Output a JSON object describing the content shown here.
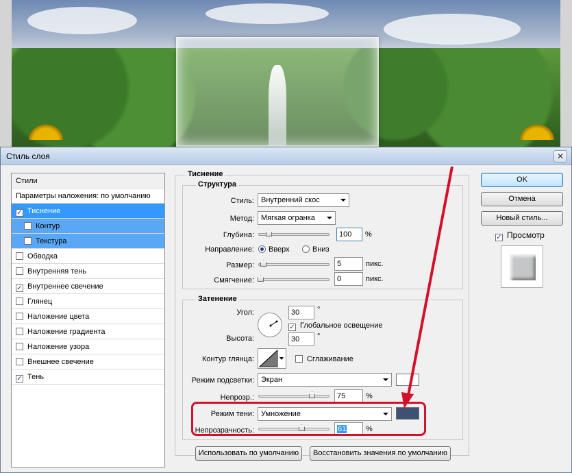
{
  "dialog": {
    "title": "Стиль слоя",
    "close_glyph": "✕"
  },
  "styles_panel": {
    "header": "Стили",
    "blend_defaults": "Параметры наложения: по умолчанию",
    "items": [
      {
        "label": "Тиснение",
        "checked": true,
        "selected": true
      },
      {
        "label": "Контур",
        "checked": false,
        "sub": true
      },
      {
        "label": "Текстура",
        "checked": false,
        "sub": true
      },
      {
        "label": "Обводка",
        "checked": false
      },
      {
        "label": "Внутренняя тень",
        "checked": false
      },
      {
        "label": "Внутреннее свечение",
        "checked": true
      },
      {
        "label": "Глянец",
        "checked": false
      },
      {
        "label": "Наложение цвета",
        "checked": false
      },
      {
        "label": "Наложение градиента",
        "checked": false
      },
      {
        "label": "Наложение узора",
        "checked": false
      },
      {
        "label": "Внешнее свечение",
        "checked": false
      },
      {
        "label": "Тень",
        "checked": true
      }
    ]
  },
  "bevel": {
    "title": "Тиснение",
    "structure": {
      "title": "Структура",
      "style_label": "Стиль:",
      "style_value": "Внутренний скос",
      "method_label": "Метод:",
      "method_value": "Мягкая огранка",
      "depth_label": "Глубина:",
      "depth_value": "100",
      "depth_unit": "%",
      "depth_level": 0.1,
      "direction_label": "Направление:",
      "dir_up": "Вверх",
      "dir_down": "Вниз",
      "size_label": "Размер:",
      "size_value": "5",
      "size_unit": "пикс.",
      "soften_label": "Смягчение:",
      "soften_value": "0",
      "soften_unit": "пикс."
    },
    "shading": {
      "title": "Затенение",
      "angle_label": "Угол:",
      "angle_value": "30",
      "deg": "°",
      "global_light": "Глобальное освещение",
      "altitude_label": "Высота:",
      "altitude_value": "30",
      "gloss_label": "Контур глянца:",
      "antialias": "Сглаживание",
      "highlight_mode_label": "Режим подсветки:",
      "highlight_mode_value": "Экран",
      "highlight_color": "#ffffff",
      "highlight_opacity_label": "Непрозр.:",
      "highlight_opacity_value": "75",
      "percent": "%",
      "shadow_mode_label": "Режим тени:",
      "shadow_mode_value": "Умножение",
      "shadow_color": "#3d5272",
      "shadow_opacity_label": "Непрозрачность:",
      "shadow_opacity_value": "61"
    },
    "make_default": "Использовать по умолчанию",
    "reset_default": "Восстановить значения по умолчанию"
  },
  "right": {
    "ok": "OK",
    "cancel": "Отмена",
    "new_style": "Новый стиль...",
    "preview": "Просмотр"
  },
  "colors": {
    "accent_red": "#d2122a",
    "selection_blue": "#3399ff"
  }
}
